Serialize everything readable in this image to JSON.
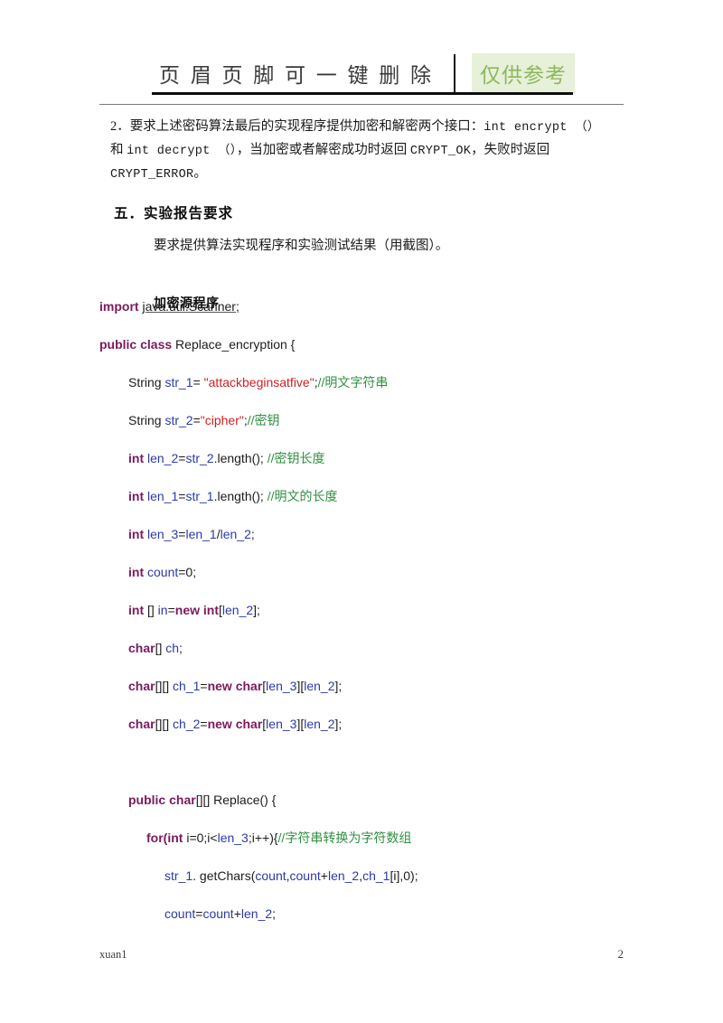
{
  "header": {
    "watermark_text": "页 眉 页 脚 可 一 键 删 除",
    "badge_text": "仅供参考",
    "badge_bg_color": "#e7f0d9",
    "badge_text_color": "#8cb85c"
  },
  "body": {
    "paragraph_2": "2．要求上述密码算法最后的实现程序提供加密和解密两个接口：int  encrypt （）和 int decrypt （），当加密或者解密成功时返回 CRYPT_OK，失败时返回 CRYPT_ERROR。",
    "paragraph_2_prefix": "2．要求上述密码算法最后的实现程序提供加密和解密两个接口：",
    "paragraph_2_code_a": "int  encrypt （）",
    "paragraph_2_mid": "和 ",
    "paragraph_2_code_b": "int decrypt （）",
    "paragraph_2_mid2": "，当加密或者解密成功时返回 ",
    "paragraph_2_code_c": "CRYPT_OK",
    "paragraph_2_mid3": "，失败时返回 ",
    "paragraph_2_code_d": "CRYPT_ERROR",
    "paragraph_2_end": "。",
    "section_heading": "五．实验报告要求",
    "section_body": "要求提供算法实现程序和实验测试结果（用截图）。",
    "code_heading": "加密源程序"
  },
  "code": {
    "lines": [
      {
        "indent": 0,
        "tokens": [
          {
            "t": "import ",
            "c": "kw"
          },
          {
            "t": "java.util.Scanner;",
            "c": "plain ul"
          }
        ]
      },
      {
        "indent": 0,
        "tokens": [
          {
            "t": "public class ",
            "c": "kw"
          },
          {
            "t": "Replace_encryption {",
            "c": "plain"
          }
        ]
      },
      {
        "indent": 1,
        "tokens": [
          {
            "t": "String ",
            "c": "plain"
          },
          {
            "t": "str_1",
            "c": "var"
          },
          {
            "t": "=   ",
            "c": "plain"
          },
          {
            "t": "\"attackbeginsatfive\"",
            "c": "str"
          },
          {
            "t": ";",
            "c": "plain"
          },
          {
            "t": "//明文字符串",
            "c": "cmt"
          }
        ]
      },
      {
        "indent": 1,
        "tokens": [
          {
            "t": "String ",
            "c": "plain"
          },
          {
            "t": "str_2",
            "c": "var"
          },
          {
            "t": "=",
            "c": "plain"
          },
          {
            "t": "\"cipher\"",
            "c": "str"
          },
          {
            "t": ";",
            "c": "plain"
          },
          {
            "t": "//密钥",
            "c": "cmt"
          }
        ]
      },
      {
        "indent": 1,
        "tokens": [
          {
            "t": "int ",
            "c": "kw"
          },
          {
            "t": "len_2",
            "c": "var"
          },
          {
            "t": "=",
            "c": "plain"
          },
          {
            "t": "str_2",
            "c": "var"
          },
          {
            "t": ".length();     ",
            "c": "plain"
          },
          {
            "t": "//密钥长度",
            "c": "cmt"
          }
        ]
      },
      {
        "indent": 1,
        "tokens": [
          {
            "t": "int ",
            "c": "kw"
          },
          {
            "t": "len_1",
            "c": "var"
          },
          {
            "t": "=",
            "c": "plain"
          },
          {
            "t": "str_1",
            "c": "var"
          },
          {
            "t": ".length();      ",
            "c": "plain"
          },
          {
            "t": "//明文的长度",
            "c": "cmt"
          }
        ]
      },
      {
        "indent": 1,
        "tokens": [
          {
            "t": "int ",
            "c": "kw"
          },
          {
            "t": "len_3",
            "c": "var"
          },
          {
            "t": "=",
            "c": "plain"
          },
          {
            "t": "len_1",
            "c": "var"
          },
          {
            "t": "/",
            "c": "plain"
          },
          {
            "t": "len_2",
            "c": "var"
          },
          {
            "t": ";",
            "c": "plain"
          }
        ]
      },
      {
        "indent": 1,
        "tokens": [
          {
            "t": "int ",
            "c": "kw"
          },
          {
            "t": "count",
            "c": "var"
          },
          {
            "t": "=0;",
            "c": "plain"
          }
        ]
      },
      {
        "indent": 1,
        "tokens": [
          {
            "t": "int ",
            "c": "kw"
          },
          {
            "t": "[] ",
            "c": "plain"
          },
          {
            "t": "in",
            "c": "var"
          },
          {
            "t": "=",
            "c": "plain"
          },
          {
            "t": "new int",
            "c": "kw"
          },
          {
            "t": "[",
            "c": "plain"
          },
          {
            "t": "len_2",
            "c": "var"
          },
          {
            "t": "];",
            "c": "plain"
          }
        ]
      },
      {
        "indent": 1,
        "tokens": [
          {
            "t": "char",
            "c": "kw"
          },
          {
            "t": "[] ",
            "c": "plain"
          },
          {
            "t": "ch",
            "c": "var"
          },
          {
            "t": ";",
            "c": "plain"
          }
        ]
      },
      {
        "indent": 1,
        "tokens": [
          {
            "t": "char",
            "c": "kw"
          },
          {
            "t": "[][] ",
            "c": "plain"
          },
          {
            "t": "ch_1",
            "c": "var"
          },
          {
            "t": "=",
            "c": "plain"
          },
          {
            "t": "new char",
            "c": "kw"
          },
          {
            "t": "[",
            "c": "plain"
          },
          {
            "t": "len_3",
            "c": "var"
          },
          {
            "t": "][",
            "c": "plain"
          },
          {
            "t": "len_2",
            "c": "var"
          },
          {
            "t": "];",
            "c": "plain"
          }
        ]
      },
      {
        "indent": 1,
        "tokens": [
          {
            "t": "char",
            "c": "kw"
          },
          {
            "t": "[][] ",
            "c": "plain"
          },
          {
            "t": "ch_2",
            "c": "var"
          },
          {
            "t": "=",
            "c": "plain"
          },
          {
            "t": "new char",
            "c": "kw"
          },
          {
            "t": "[",
            "c": "plain"
          },
          {
            "t": "len_3",
            "c": "var"
          },
          {
            "t": "][",
            "c": "plain"
          },
          {
            "t": "len_2",
            "c": "var"
          },
          {
            "t": "];",
            "c": "plain"
          }
        ]
      },
      {
        "indent": 0,
        "tokens": []
      },
      {
        "indent": 1,
        "tokens": [
          {
            "t": "public   char",
            "c": "kw"
          },
          {
            "t": "[][] Replace() {",
            "c": "plain"
          }
        ]
      },
      {
        "indent": 2,
        "tokens": [
          {
            "t": "for(",
            "c": "kw"
          },
          {
            "t": "int ",
            "c": "kw"
          },
          {
            "t": "i=0;i<",
            "c": "plain"
          },
          {
            "t": "len_3",
            "c": "var"
          },
          {
            "t": ";i++){",
            "c": "plain"
          },
          {
            "t": "//字符串转换为字符数组",
            "c": "cmt"
          }
        ]
      },
      {
        "indent": 3,
        "tokens": [
          {
            "t": "str_1",
            "c": "var"
          },
          {
            "t": ". getChars(",
            "c": "plain"
          },
          {
            "t": "count",
            "c": "var"
          },
          {
            "t": ",",
            "c": "plain"
          },
          {
            "t": "count",
            "c": "var"
          },
          {
            "t": "+",
            "c": "plain"
          },
          {
            "t": "len_2",
            "c": "var"
          },
          {
            "t": ",",
            "c": "plain"
          },
          {
            "t": "ch_1",
            "c": "var"
          },
          {
            "t": "[i],0);",
            "c": "plain"
          }
        ]
      },
      {
        "indent": 3,
        "tokens": [
          {
            "t": "count",
            "c": "var"
          },
          {
            "t": "=",
            "c": "plain"
          },
          {
            "t": "count",
            "c": "var"
          },
          {
            "t": "+",
            "c": "plain"
          },
          {
            "t": "len_2",
            "c": "var"
          },
          {
            "t": ";",
            "c": "plain"
          }
        ]
      }
    ]
  },
  "footer": {
    "left_text": "xuan1",
    "page_number": "2"
  }
}
